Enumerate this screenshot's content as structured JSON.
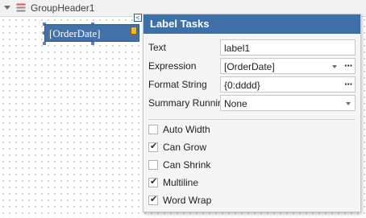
{
  "band": {
    "title": "GroupHeader1"
  },
  "label_control": {
    "text": "[OrderDate]"
  },
  "panel": {
    "title": "Label Tasks",
    "text": {
      "label": "Text",
      "value": "label1"
    },
    "expression": {
      "label": "Expression",
      "value": "[OrderDate]",
      "ellipsis": "···"
    },
    "format_string": {
      "label": "Format String",
      "value": "{0:dddd}",
      "ellipsis": "···"
    },
    "summary_running": {
      "label": "Summary Running",
      "value": "None"
    },
    "checkboxes": [
      {
        "label": "Auto Width",
        "checked": false
      },
      {
        "label": "Can Grow",
        "checked": true
      },
      {
        "label": "Can Shrink",
        "checked": false
      },
      {
        "label": "Multiline",
        "checked": true
      },
      {
        "label": "Word Wrap",
        "checked": true
      }
    ]
  },
  "colors": {
    "accent": "#3e6fa6",
    "label_fill": "#4472a8"
  }
}
